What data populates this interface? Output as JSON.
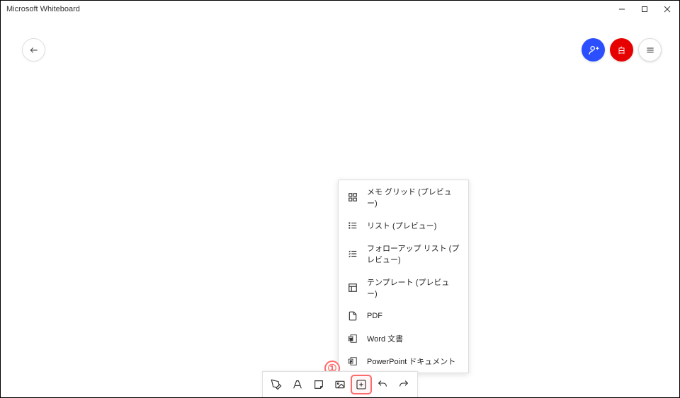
{
  "window": {
    "title": "Microsoft Whiteboard"
  },
  "menu": {
    "items": [
      {
        "label": "メモ グリッド (プレビュー)"
      },
      {
        "label": "リスト (プレビュー)"
      },
      {
        "label": "フォローアップ リスト (プレビュー)"
      },
      {
        "label": "テンプレート (プレビュー)"
      },
      {
        "label": "PDF"
      },
      {
        "label": "Word 文書"
      },
      {
        "label": "PowerPoint ドキュメント"
      }
    ]
  },
  "annotation": {
    "label": "①"
  },
  "avatar": {
    "red_label": "白"
  }
}
